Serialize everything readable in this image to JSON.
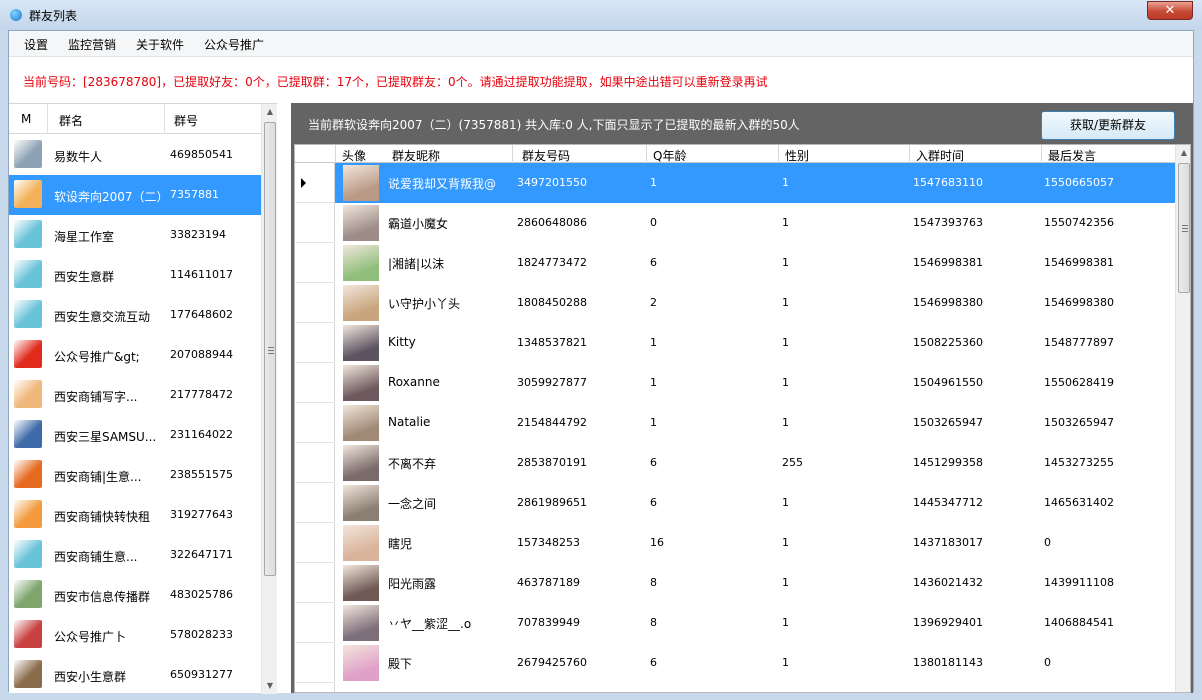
{
  "window": {
    "title": "群友列表",
    "close_label": "✕"
  },
  "menu": [
    "设置",
    "监控营销",
    "关于软件",
    "公众号推广"
  ],
  "notice": "当前号码：[283678780]，已提取好友：0个，已提取群：17个，已提取群友：0个。请通过提取功能提取，如果中途出错可以重新登录再试",
  "group_list": {
    "headers": [
      "M",
      "群名",
      "群号"
    ],
    "items": [
      {
        "name": "易数牛人",
        "number": "469850541",
        "icon": "person-avatar",
        "color": "#8ea2b6"
      },
      {
        "name": "软设奔向2007（二）",
        "number": "7357881",
        "icon": "doc-avatar",
        "color": "#f3b25a"
      },
      {
        "name": "海星工作室",
        "number": "33823194",
        "icon": "handshake-avatar",
        "color": "#68c3d9"
      },
      {
        "name": "西安生意群",
        "number": "114611017",
        "icon": "handshake-avatar",
        "color": "#68c3d9"
      },
      {
        "name": "西安生意交流互动",
        "number": "177648602",
        "icon": "handshake-avatar",
        "color": "#68c3d9"
      },
      {
        "name": "公众号推广&gt;",
        "number": "207088944",
        "icon": "redpacket-avatar",
        "color": "#e02a1c"
      },
      {
        "name": "西安商铺写字...",
        "number": "217778472",
        "icon": "cartoon-avatar",
        "color": "#f0b77a"
      },
      {
        "name": "西安三星SAMSU...",
        "number": "231164022",
        "icon": "samsung-avatar",
        "color": "#3d6aa8"
      },
      {
        "name": "西安商铺|生意...",
        "number": "238551575",
        "icon": "logo-avatar",
        "color": "#e66a1f"
      },
      {
        "name": "西安商铺快转快租",
        "number": "319277643",
        "icon": "briefcase-avatar",
        "color": "#f29a3c"
      },
      {
        "name": "西安商铺生意...",
        "number": "322647171",
        "icon": "handshake-avatar",
        "color": "#68c3d9"
      },
      {
        "name": "西安市信息传播群",
        "number": "483025786",
        "icon": "photo-avatar",
        "color": "#7fa46c"
      },
      {
        "name": "公众号推广卜",
        "number": "578028233",
        "icon": "seal-avatar",
        "color": "#c94040"
      },
      {
        "name": "西安小生意群",
        "number": "650931277",
        "icon": "building-avatar",
        "color": "#8a6b4c"
      }
    ],
    "selected": 1
  },
  "members_panel": {
    "info": "当前群软设奔向2007（二）(7357881) 共入库:0 人,下面只显示了已提取的最新入群的50人",
    "refresh_button": "获取/更新群友",
    "columns": [
      "头像",
      "群友昵称",
      "群友号码",
      "Q年龄",
      "性别",
      "入群时间",
      "最后发言"
    ],
    "rows": [
      {
        "nick": "说爱我却又背叛我@",
        "qq": "3497201550",
        "age": "1",
        "sex": "1",
        "join": "1547683110",
        "last": "1550665057",
        "photo_color": "#b99a86"
      },
      {
        "nick": "霸道小魔女",
        "qq": "2860648086",
        "age": "0",
        "sex": "1",
        "join": "1547393763",
        "last": "1550742356",
        "photo_color": "#9d8c88"
      },
      {
        "nick": "|湘諸|以沫",
        "qq": "1824773472",
        "age": "6",
        "sex": "1",
        "join": "1546998381",
        "last": "1546998381",
        "photo_color": "#8fbf7a"
      },
      {
        "nick": "い守护小丫头",
        "qq": "1808450288",
        "age": "2",
        "sex": "1",
        "join": "1546998380",
        "last": "1546998380",
        "photo_color": "#c8a57c"
      },
      {
        "nick": "Kitty",
        "qq": "1348537821",
        "age": "1",
        "sex": "1",
        "join": "1508225360",
        "last": "1548777897",
        "photo_color": "#5d5462"
      },
      {
        "nick": "Roxanne",
        "qq": "3059927877",
        "age": "1",
        "sex": "1",
        "join": "1504961550",
        "last": "1550628419",
        "photo_color": "#6e5a5e"
      },
      {
        "nick": "Natalie",
        "qq": "2154844792",
        "age": "1",
        "sex": "1",
        "join": "1503265947",
        "last": "1503265947",
        "photo_color": "#a08a76"
      },
      {
        "nick": "不离不弃",
        "qq": "2853870191",
        "age": "6",
        "sex": "255",
        "join": "1451299358",
        "last": "1453273255",
        "photo_color": "#7a6a6a"
      },
      {
        "nick": "一念之间",
        "qq": "2861989651",
        "age": "6",
        "sex": "1",
        "join": "1445347712",
        "last": "1465631402",
        "photo_color": "#8b7f73"
      },
      {
        "nick": "瞎児",
        "qq": "157348253",
        "age": "16",
        "sex": "1",
        "join": "1437183017",
        "last": "0",
        "photo_color": "#d9b39a"
      },
      {
        "nick": "阳光雨露",
        "qq": "463787189",
        "age": "8",
        "sex": "1",
        "join": "1436021432",
        "last": "1439911108",
        "photo_color": "#6f5a55"
      },
      {
        "nick": "丷ヤ__紫涩__.o",
        "qq": "707839949",
        "age": "8",
        "sex": "1",
        "join": "1396929401",
        "last": "1406884541",
        "photo_color": "#7d6f7a"
      },
      {
        "nick": "殿下",
        "qq": "2679425760",
        "age": "6",
        "sex": "1",
        "join": "1380181143",
        "last": "0",
        "photo_color": "#e0a0c8"
      }
    ],
    "selected": 0
  }
}
